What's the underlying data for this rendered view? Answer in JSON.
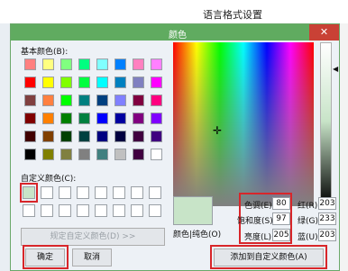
{
  "parent_window": {
    "title": "语言格式设置"
  },
  "dialog": {
    "title": "颜色",
    "close_glyph": "✕"
  },
  "basic_colors": {
    "label": "基本颜色(B):",
    "rows": [
      [
        "#ff8080",
        "#ffff80",
        "#80ff80",
        "#00ff80",
        "#80ffff",
        "#0080ff",
        "#ff80c0",
        "#ff80ff"
      ],
      [
        "#ff0000",
        "#ffff00",
        "#80ff00",
        "#00ff40",
        "#00ffff",
        "#0080c0",
        "#8080c0",
        "#ff00ff"
      ],
      [
        "#804040",
        "#ff8040",
        "#00ff00",
        "#008080",
        "#004080",
        "#8080ff",
        "#800040",
        "#ff0080"
      ],
      [
        "#800000",
        "#ff8000",
        "#008000",
        "#008040",
        "#0000ff",
        "#0000a0",
        "#800080",
        "#8000ff"
      ],
      [
        "#400000",
        "#804000",
        "#004000",
        "#004040",
        "#000080",
        "#000040",
        "#400040",
        "#400080"
      ],
      [
        "#000000",
        "#808000",
        "#808040",
        "#808080",
        "#408080",
        "#c0c0c0",
        "#400040",
        "#ffffff"
      ]
    ]
  },
  "custom_colors": {
    "label": "自定义颜色(C):",
    "rows": [
      [
        "#c8e4c8",
        "#ffffff",
        "#ffffff",
        "#ffffff",
        "#ffffff",
        "#ffffff",
        "#ffffff",
        "#ffffff"
      ],
      [
        "#ffffff",
        "#ffffff",
        "#ffffff",
        "#ffffff",
        "#ffffff",
        "#ffffff",
        "#ffffff",
        "#ffffff"
      ]
    ]
  },
  "buttons": {
    "define_custom": "规定自定义颜色(D) >>",
    "ok": "确定",
    "cancel": "取消",
    "add_custom": "添加到自定义颜色(A)"
  },
  "preview_label": "颜色|纯色(O)",
  "hsl": {
    "hue_label": "色调(E):",
    "hue": "80",
    "sat_label": "饱和度(S):",
    "sat": "97",
    "lum_label": "亮度(L):",
    "lum": "205"
  },
  "rgb": {
    "red_label": "红(R):",
    "red": "203",
    "green_label": "绿(G):",
    "green": "233",
    "blue_label": "蓝(U):",
    "blue": "203"
  },
  "selected_color": "#c8e4c8",
  "highlight_color": "#d8262a"
}
